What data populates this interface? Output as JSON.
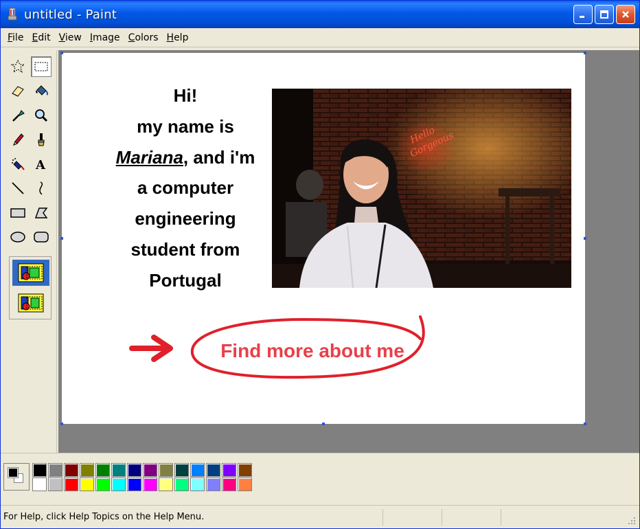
{
  "window": {
    "title": "untitled - Paint",
    "controls": [
      "minimize-icon",
      "maximize-icon",
      "close-icon"
    ]
  },
  "menu": {
    "items": [
      {
        "first": "F",
        "rest": "ile"
      },
      {
        "first": "E",
        "rest": "dit"
      },
      {
        "first": "V",
        "rest": "iew"
      },
      {
        "first": "I",
        "rest": "mage"
      },
      {
        "first": "C",
        "rest": "olors"
      },
      {
        "first": "H",
        "rest": "elp"
      }
    ]
  },
  "tools": [
    "free-form-select-icon",
    "rectangle-select-icon",
    "eraser-icon",
    "fill-bucket-icon",
    "color-picker-icon",
    "magnifier-icon",
    "pencil-icon",
    "brush-icon",
    "airbrush-icon",
    "text-icon",
    "line-icon",
    "curve-icon",
    "rectangle-icon",
    "polygon-icon",
    "ellipse-icon",
    "rounded-rectangle-icon"
  ],
  "canvas": {
    "intro_line1": "Hi!",
    "intro_line2": "my name is",
    "intro_name": "Mariana",
    "intro_after_name": ", and i'm",
    "intro_line4": "a computer",
    "intro_line5": "engineering",
    "intro_line6": "student from",
    "intro_line7": "Portugal",
    "link_text": "Find more about me",
    "accent_color": "#e8404a"
  },
  "palette": {
    "foreground": "#000000",
    "background": "#ffffff",
    "colors_top": [
      "#000000",
      "#808080",
      "#800000",
      "#808000",
      "#008000",
      "#008080",
      "#000080",
      "#800080",
      "#808040",
      "#004040",
      "#0080ff",
      "#004080",
      "#8000ff",
      "#804000"
    ],
    "colors_bottom": [
      "#ffffff",
      "#c0c0c0",
      "#ff0000",
      "#ffff00",
      "#00ff00",
      "#00ffff",
      "#0000ff",
      "#ff00ff",
      "#ffff80",
      "#00ff80",
      "#80ffff",
      "#8080ff",
      "#ff0080",
      "#ff8040"
    ]
  },
  "status": {
    "help_text": "For Help, click Help Topics on the Help Menu."
  }
}
